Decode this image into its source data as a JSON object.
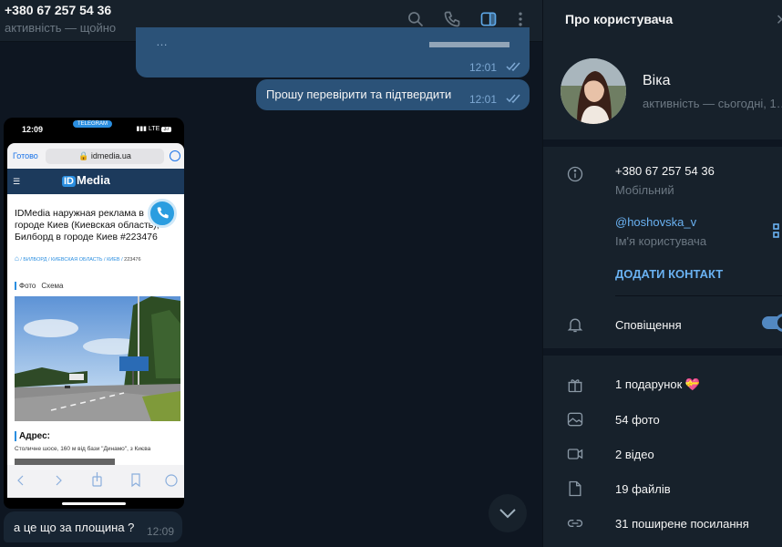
{
  "chat": {
    "title": "+380 67 257 54 36",
    "status": "активність — щойно",
    "messages": [
      {
        "text": "…",
        "time": "12:01"
      },
      {
        "text": "Прошу перевірити та підтвердити",
        "time": "12:01"
      },
      {
        "text": "а це що за площина ?",
        "time": "12:09"
      }
    ]
  },
  "screenshot": {
    "time": "12:09",
    "tg_label": "TELEGRAM",
    "network": "LTE",
    "battery": "37",
    "safari_done": "Готово",
    "url": "🔒 idmedia.ua",
    "logo_id": "ID",
    "logo_text": "Media",
    "headline": "IDMedia наружная реклама в городе Киев (Киевская область), Билборд в городе Киев #223476",
    "crumbs": " / БИЛБОРД / КИЕВСКАЯ ОБЛАСТЬ / КИЕВ / ",
    "crumb_tail": "223476",
    "tab_photo": "Фото",
    "tab_scheme": "Схема",
    "addr_title": "Адрес:",
    "addr_text": "Столичне шосе, 160 м від бази \"Динамо\", з Києва"
  },
  "panel": {
    "title": "Про користувача",
    "name": "Віка",
    "status": "активність — сьогодні, 1…",
    "phone": "+380 67 257 54 36",
    "phone_label": "Мобільний",
    "username": "@hoshovska_v",
    "username_label": "Ім'я користувача",
    "add_contact": "ДОДАТИ КОНТАКТ",
    "notifications": "Сповіщення",
    "gifts": "1 подарунок 💝",
    "photos": "54 фото",
    "videos": "2 відео",
    "files": "19 файлів",
    "links": "31 поширене посилання"
  },
  "colors": {
    "bg": "#0e1621",
    "panel": "#17212b",
    "outgoing": "#2b5278",
    "incoming": "#182533",
    "accent": "#6ab2f2"
  }
}
